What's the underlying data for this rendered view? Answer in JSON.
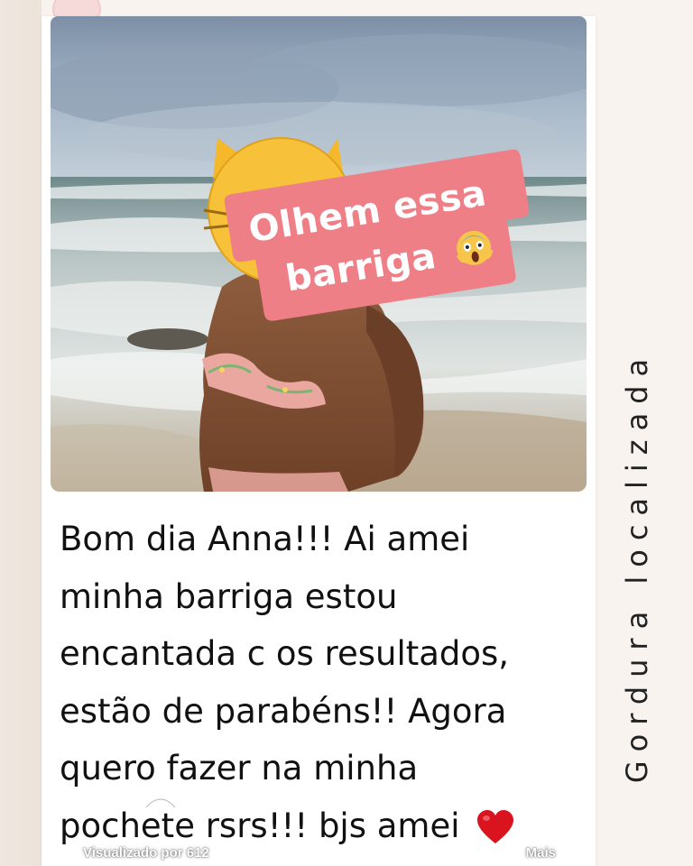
{
  "story": {
    "sticker": {
      "line1": "Olhem essa",
      "line2": "barriga",
      "emoji_icon": "face-screaming-in-fear-icon",
      "color": "#ef7f86"
    },
    "message": {
      "lines": [
        "Bom dia Anna!!! Ai amei",
        "minha barriga estou",
        "encantada c os resultados,",
        "estão de parabéns!! Agora",
        "quero fazer na minha",
        "pochete rsrs!!! bjs amei"
      ],
      "end_icon": "red-heart-icon"
    },
    "side_title": "Gordura localizada",
    "footer": {
      "seen_label": "Visualizado por 612",
      "more_label": "Mais"
    }
  },
  "colors": {
    "background": "#f8f3ef",
    "card": "#ffffff",
    "text": "#111111",
    "heart": "#d9141e"
  }
}
